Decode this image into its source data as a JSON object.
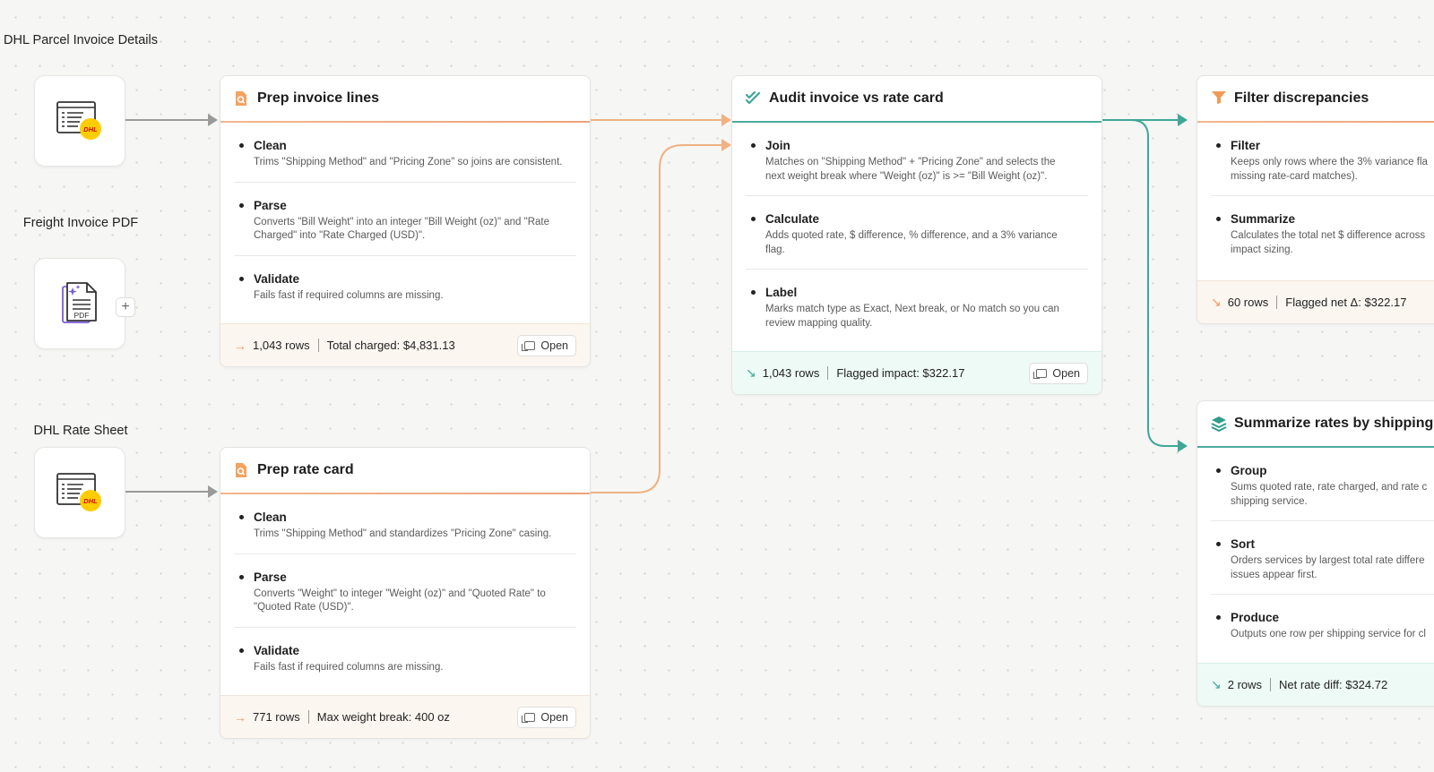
{
  "sources": [
    {
      "label": "DHL Parcel Invoice Details",
      "icon": "dhl-invoice-icon"
    },
    {
      "label": "Freight Invoice PDF",
      "icon": "pdf-document-icon",
      "badge_text": "PDF"
    },
    {
      "label": "DHL Rate Sheet",
      "icon": "dhl-invoice-icon"
    }
  ],
  "logo_text": "DHL",
  "add_button": "+",
  "open_label": "Open",
  "colors": {
    "orange": "#eea27a",
    "teal": "#3ea797",
    "connector_gray": "#9a9a98",
    "dhl_yellow": "#ffcc00",
    "dhl_red": "#d40511",
    "pdf_purple": "#7b5cd6"
  },
  "cards": {
    "prep_invoice": {
      "title": "Prep invoice lines",
      "icon": "document-search-icon",
      "steps": [
        {
          "title": "Clean",
          "desc": [
            "Trims \"Shipping Method\" and \"Pricing Zone\" so joins are consistent."
          ]
        },
        {
          "title": "Parse",
          "desc": [
            "Converts \"Bill Weight\" into an integer \"Bill Weight (oz)\" and \"Rate",
            "Charged\" into \"Rate Charged (USD)\"."
          ]
        },
        {
          "title": "Validate",
          "desc": [
            "Fails fast if required columns are missing."
          ]
        }
      ],
      "footer": {
        "arrow": "→",
        "rows": "1,043 rows",
        "metric": "Total charged: $4,831.13"
      }
    },
    "prep_rate": {
      "title": "Prep rate card",
      "icon": "document-search-icon",
      "steps": [
        {
          "title": "Clean",
          "desc": [
            "Trims \"Shipping Method\" and standardizes \"Pricing Zone\" casing."
          ]
        },
        {
          "title": "Parse",
          "desc": [
            "Converts \"Weight\" to integer \"Weight (oz)\" and \"Quoted Rate\" to",
            "\"Quoted Rate (USD)\"."
          ]
        },
        {
          "title": "Validate",
          "desc": [
            "Fails fast if required columns are missing."
          ]
        }
      ],
      "footer": {
        "arrow": "→",
        "rows": "771 rows",
        "metric": "Max weight break: 400 oz"
      }
    },
    "audit": {
      "title": "Audit invoice vs rate card",
      "icon": "double-check-icon",
      "steps": [
        {
          "title": "Join",
          "desc": [
            "Matches on \"Shipping Method\" + \"Pricing Zone\" and selects the",
            "next weight break where \"Weight (oz)\" is >= \"Bill Weight (oz)\"."
          ]
        },
        {
          "title": "Calculate",
          "desc": [
            "Adds quoted rate, $ difference, % difference, and a 3% variance",
            "flag."
          ]
        },
        {
          "title": "Label",
          "desc": [
            "Marks match type as Exact, Next break, or No match so you can",
            "review mapping quality."
          ]
        }
      ],
      "footer": {
        "arrow": "↘",
        "rows": "1,043 rows",
        "metric": "Flagged impact: $322.17"
      }
    },
    "filter": {
      "title": "Filter discrepancies",
      "icon": "funnel-icon",
      "steps": [
        {
          "title": "Filter",
          "desc": [
            "Keeps only rows where the 3% variance fla",
            "missing rate-card matches)."
          ]
        },
        {
          "title": "Summarize",
          "desc": [
            "Calculates the total net $ difference across",
            "impact sizing."
          ]
        }
      ],
      "footer": {
        "arrow": "↘",
        "rows": "60 rows",
        "metric": "Flagged net Δ: $322.17"
      }
    },
    "summarize": {
      "title": "Summarize rates by shipping",
      "icon": "layers-icon",
      "steps": [
        {
          "title": "Group",
          "desc": [
            "Sums quoted rate, rate charged, and rate c",
            "shipping service."
          ]
        },
        {
          "title": "Sort",
          "desc": [
            "Orders services by largest total rate differe",
            "issues appear first."
          ]
        },
        {
          "title": "Produce",
          "desc": [
            "Outputs one row per shipping service for cl"
          ]
        }
      ],
      "footer": {
        "arrow": "↘",
        "rows": "2 rows",
        "metric": "Net rate diff: $324.72"
      }
    }
  }
}
